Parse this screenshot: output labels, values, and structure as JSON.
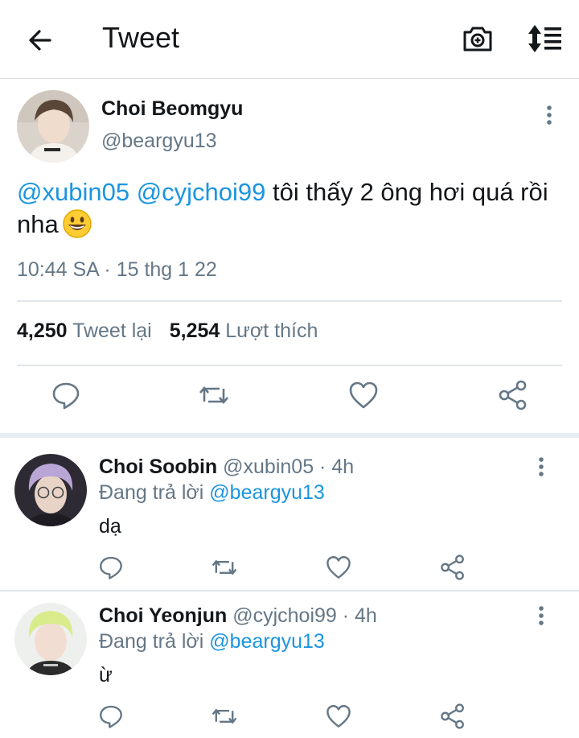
{
  "header": {
    "title": "Tweet",
    "back_icon": "arrow-left-icon",
    "camera_icon": "camera-icon",
    "sort_icon": "sort-icon"
  },
  "tweet": {
    "author_name": "Choi Beomgyu",
    "author_handle": "@beargyu13",
    "text_mention_1": "@xubin05",
    "text_mention_2": "@cyjchoi99",
    "text_body": " tôi thấy 2 ông hơi quá rồi nha",
    "emoji": "grinning-face-emoji",
    "timestamp": "10:44 SA · 15 thg 1 22",
    "retweet_count": "4,250",
    "retweet_label": "Tweet lại",
    "like_count": "5,254",
    "like_label": "Lượt thích"
  },
  "replies": [
    {
      "name": "Choi Soobin",
      "meta": " @xubin05 · 4h",
      "replying_label": "Đang trả lời ",
      "replying_handle": "@beargyu13",
      "text": "dạ"
    },
    {
      "name": "Choi Yeonjun",
      "meta": " @cyjchoi99 · 4h",
      "replying_label": "Đang trả lời ",
      "replying_handle": "@beargyu13",
      "text": "ừ"
    }
  ],
  "colors": {
    "link": "#1b95e0",
    "secondary_text": "#657786",
    "icon": "#657786",
    "primary_text": "#14171a"
  }
}
